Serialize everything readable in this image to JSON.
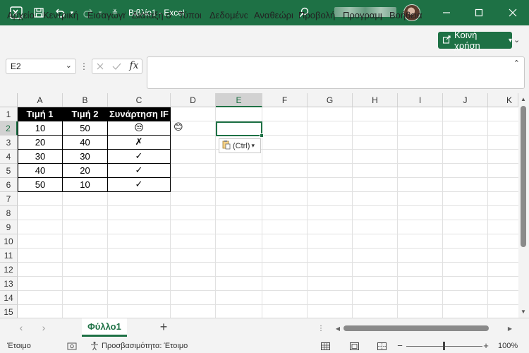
{
  "titlebar": {
    "title": "Βιβλίο1 - Excel"
  },
  "menu": {
    "items": [
      "Αρχείο",
      "Κεντρική",
      "Εισαγωγή",
      "Διάταξη σελίδας",
      "Τύποι",
      "Δεδομένα",
      "Αναθεώρηση",
      "Προβολή",
      "Προγραμματιστής",
      "Βοήθεια"
    ],
    "share_label": "Κοινή χρήση"
  },
  "formula_bar": {
    "name_box": "E2",
    "fx_label": "fx",
    "formula": ""
  },
  "sheet": {
    "columns": [
      "A",
      "B",
      "C",
      "D",
      "E",
      "F",
      "G",
      "H",
      "I",
      "J",
      "K"
    ],
    "rows": [
      "1",
      "2",
      "3",
      "4",
      "5",
      "6",
      "7",
      "8",
      "9",
      "10",
      "11",
      "12",
      "13",
      "14",
      "15"
    ],
    "header_cells": [
      "Τιμή 1",
      "Τιμή 2",
      "Συνάρτηση IF"
    ],
    "data_rows": [
      [
        "10",
        "50",
        "😒"
      ],
      [
        "20",
        "40",
        "✗"
      ],
      [
        "30",
        "30",
        "✓"
      ],
      [
        "40",
        "20",
        "✓"
      ],
      [
        "50",
        "10",
        "✓"
      ]
    ],
    "d2_value": "😊",
    "paste_options_label": "(Ctrl)",
    "selected_cell": "E2"
  },
  "tabs": {
    "sheet_name": "Φύλλο1",
    "add_label": "+"
  },
  "status": {
    "ready": "Έτοιμο",
    "accessibility": "Προσβασιμότητα: Έτοιμο",
    "zoom": "100%"
  },
  "colors": {
    "accent": "#1e7145",
    "background": "#f3f3f3"
  }
}
